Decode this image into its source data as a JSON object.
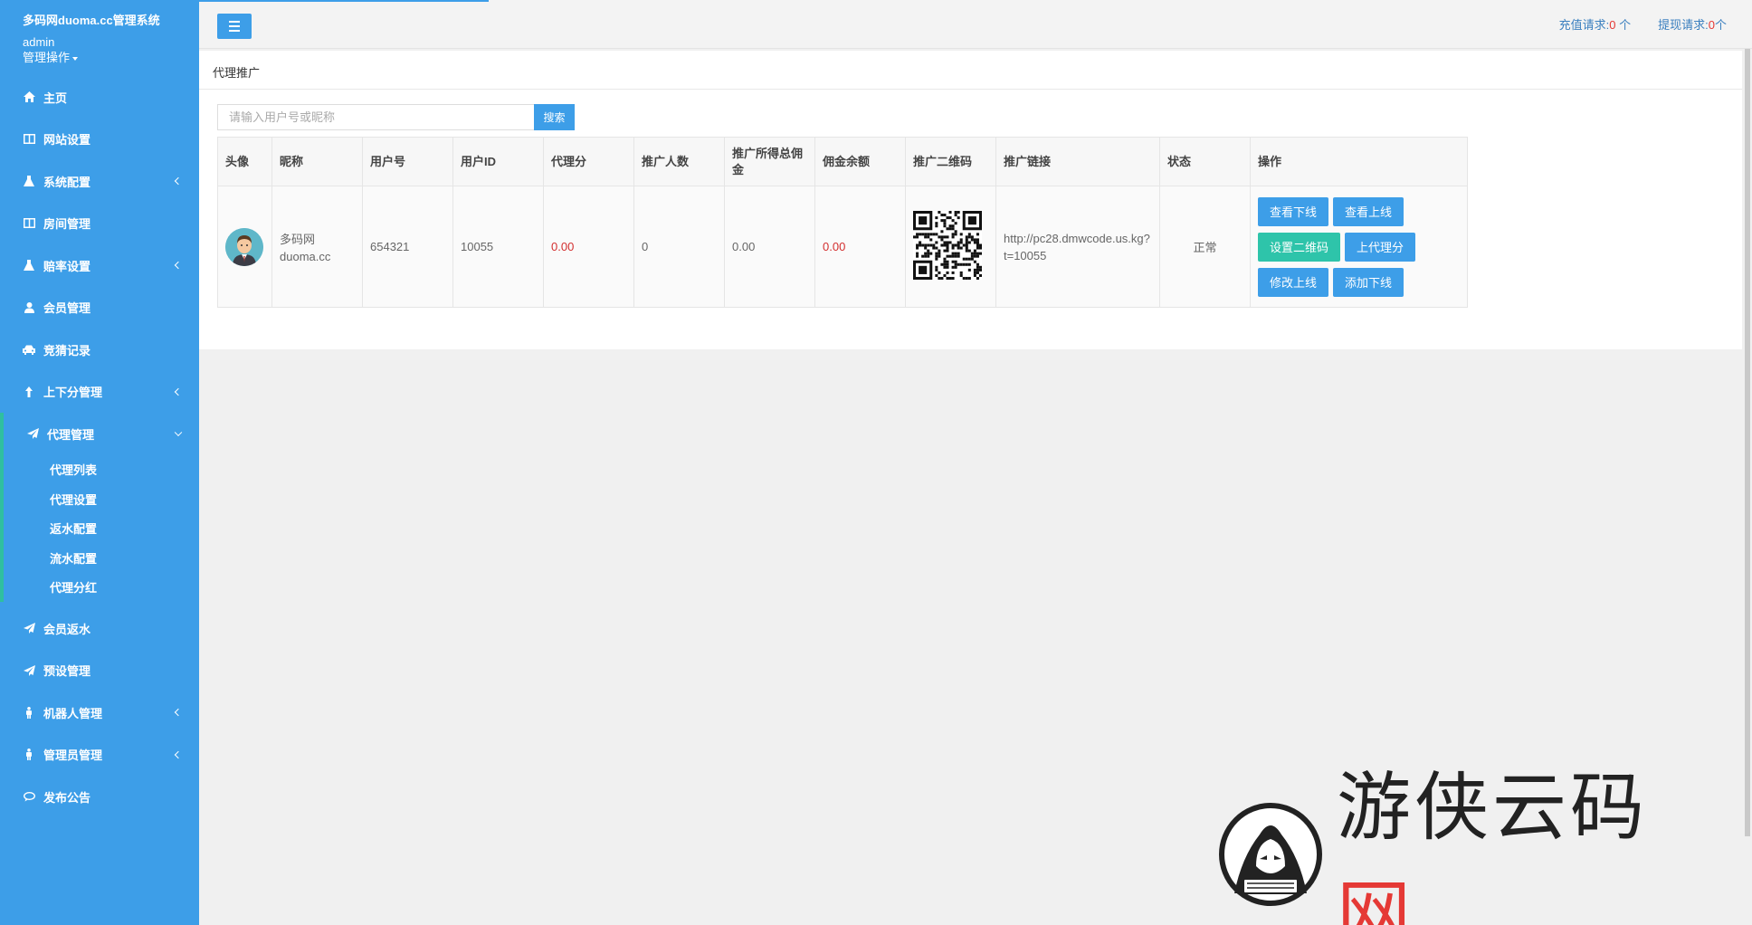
{
  "sidebar": {
    "brand": "多码网duoma.cc管理系统",
    "user": "admin",
    "user_menu": "管理操作",
    "items": [
      {
        "label": "主页",
        "icon": "home-icon"
      },
      {
        "label": "网站设置",
        "icon": "columns-icon"
      },
      {
        "label": "系统配置",
        "icon": "flask-icon"
      },
      {
        "label": "房间管理",
        "icon": "columns-icon"
      },
      {
        "label": "赔率设置",
        "icon": "flask-icon"
      },
      {
        "label": "会员管理",
        "icon": "user-icon"
      },
      {
        "label": "竞猜记录",
        "icon": "car-icon"
      },
      {
        "label": "上下分管理",
        "icon": "upload-icon"
      }
    ],
    "agent_group": {
      "label": "代理管理",
      "children": [
        "代理列表",
        "代理设置",
        "返水配置",
        "流水配置",
        "代理分红"
      ]
    },
    "items_after": [
      {
        "label": "会员返水",
        "icon": "send-icon"
      },
      {
        "label": "预设管理",
        "icon": "send-icon"
      },
      {
        "label": "机器人管理",
        "icon": "male-icon"
      },
      {
        "label": "管理员管理",
        "icon": "male-icon"
      },
      {
        "label": "发布公告",
        "icon": "comment-icon"
      }
    ]
  },
  "topbar": {
    "recharge_label": "充值请求:",
    "recharge_count": "0",
    "recharge_unit": " 个",
    "withdraw_label": "提现请求:",
    "withdraw_count": "0",
    "withdraw_unit": "个"
  },
  "panel": {
    "title": "代理推广",
    "search_placeholder": "请输入用户号或昵称",
    "search_button": "搜索"
  },
  "table": {
    "headers": [
      "头像",
      "昵称",
      "用户号",
      "用户ID",
      "代理分",
      "推广人数",
      "推广所得总佣金",
      "佣金余额",
      "推广二维码",
      "推广链接",
      "状态",
      "操作"
    ],
    "row": {
      "nickname_line1": "多码网",
      "nickname_line2": "duoma.cc",
      "user_no": "654321",
      "user_id": "10055",
      "agent_score": "0.00",
      "promo_count": "0",
      "total_commission": "0.00",
      "commission_balance": "0.00",
      "link": "http://pc28.dmwcode.us.kg?t=10055",
      "status": "正常",
      "actions": [
        "查看下线",
        "查看上线",
        "设置二维码",
        "上代理分",
        "修改上线",
        "添加下线"
      ]
    }
  },
  "watermark": {
    "text": "游侠云码",
    "text_red": "网"
  },
  "colors": {
    "sidebar": "#3d9ee8",
    "accent_teal": "#2ec4aa",
    "value_red": "#d32f2f"
  }
}
